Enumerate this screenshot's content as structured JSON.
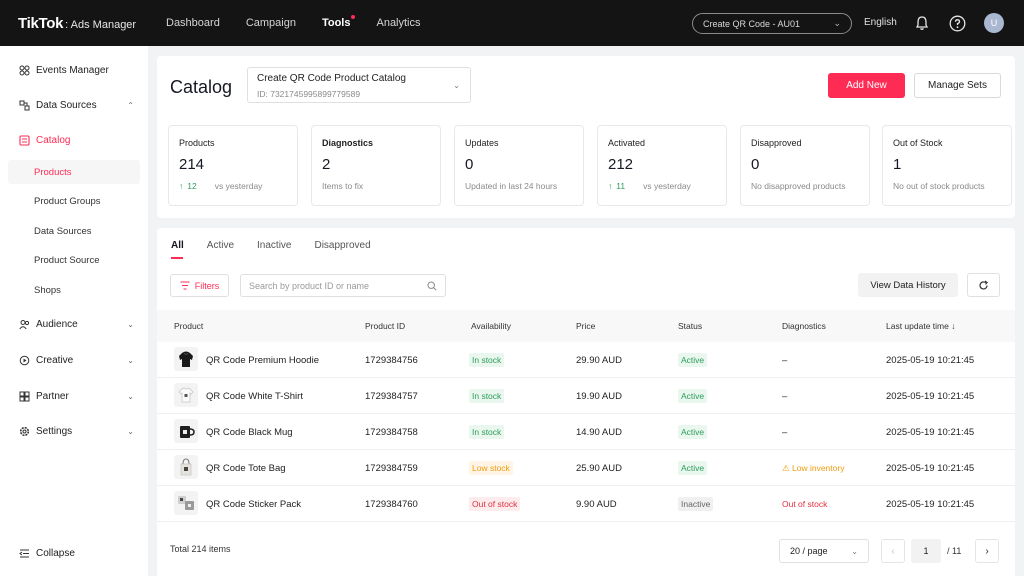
{
  "topbar": {
    "brand": "TikTok",
    "brand_sub": ": Ads Manager",
    "nav": [
      {
        "label": "Dashboard"
      },
      {
        "label": "Campaign"
      },
      {
        "label": "Tools"
      },
      {
        "label": "Analytics"
      }
    ],
    "account": "Create QR Code - AU01",
    "language": "English",
    "avatar_initial": "U"
  },
  "sidebar": {
    "items": [
      {
        "label": "Events Manager",
        "icon": "events-icon"
      },
      {
        "label": "Data Sources",
        "icon": "data-sources-icon"
      },
      {
        "label": "Catalog",
        "icon": "catalog-icon"
      },
      {
        "label": "Audience",
        "icon": "audience-icon"
      },
      {
        "label": "Creative",
        "icon": "creative-icon"
      },
      {
        "label": "Partner",
        "icon": "partner-icon"
      },
      {
        "label": "Settings",
        "icon": "gear-icon"
      }
    ],
    "catalog_sub": [
      {
        "label": "Products"
      },
      {
        "label": "Product Groups"
      },
      {
        "label": "Data Sources"
      },
      {
        "label": "Product Source"
      },
      {
        "label": "Shops"
      }
    ],
    "collapse": "Collapse"
  },
  "header": {
    "title": "Catalog",
    "catalog_name": "Create QR Code Product Catalog",
    "catalog_id": "ID: 7321745995899779589",
    "add_new": "Add New",
    "manage_sets": "Manage Sets"
  },
  "stats": [
    {
      "label": "Products",
      "value": "214",
      "delta": "12",
      "sub": "vs yesterday"
    },
    {
      "label": "Diagnostics",
      "value": "2",
      "sub": "Items to fix"
    },
    {
      "label": "Updates",
      "value": "0",
      "sub": "Updated in last 24 hours"
    },
    {
      "label": "Activated",
      "value": "212",
      "delta": "11",
      "sub": "vs yesterday"
    },
    {
      "label": "Disapproved",
      "value": "0",
      "sub": "No disapproved products"
    },
    {
      "label": "Out of Stock",
      "value": "1",
      "sub": "No out of stock products"
    }
  ],
  "tabs": [
    {
      "label": "All"
    },
    {
      "label": "Active"
    },
    {
      "label": "Inactive"
    },
    {
      "label": "Disapproved"
    }
  ],
  "toolbar": {
    "filters": "Filters",
    "search_placeholder": "Search by product ID or name",
    "view_history": "View Data History"
  },
  "table": {
    "columns": [
      "Product",
      "Product ID",
      "Availability",
      "Price",
      "Status",
      "Diagnostics",
      "Last update time"
    ],
    "rows": [
      {
        "name": "QR Code Premium Hoodie",
        "id": "1729384756",
        "availability": "In stock",
        "price": "29.90 AUD",
        "status": "Active",
        "diagnostics": "–",
        "updated": "2025-05-19 10:21:45",
        "thumb": "hoodie-icon"
      },
      {
        "name": "QR Code White T-Shirt",
        "id": "1729384757",
        "availability": "In stock",
        "price": "19.90 AUD",
        "status": "Active",
        "diagnostics": "–",
        "updated": "2025-05-19 10:21:45",
        "thumb": "tshirt-icon"
      },
      {
        "name": "QR Code Black Mug",
        "id": "1729384758",
        "availability": "In stock",
        "price": "14.90 AUD",
        "status": "Active",
        "diagnostics": "–",
        "updated": "2025-05-19 10:21:45",
        "thumb": "mug-icon"
      },
      {
        "name": "QR Code Tote Bag",
        "id": "1729384759",
        "availability": "Low stock",
        "price": "25.90 AUD",
        "status": "Active",
        "diagnostics": "Low inventory",
        "updated": "2025-05-19 10:21:45",
        "thumb": "tote-bag-icon"
      },
      {
        "name": "QR Code Sticker Pack",
        "id": "1729384760",
        "availability": "Out of stock",
        "price": "9.90 AUD",
        "status": "Inactive",
        "diagnostics": "Out of stock",
        "updated": "2025-05-19 10:21:45",
        "thumb": "sticker-icon"
      }
    ]
  },
  "footer": {
    "total": "Total 214 items",
    "page_size": "20 / page",
    "current_page": "1",
    "total_pages": "/ 11"
  },
  "colors": {
    "accent": "#fe2c55",
    "in_stock": "#2d9d5b",
    "low_stock": "#f29b0e",
    "out_of_stock": "#e0303e"
  }
}
